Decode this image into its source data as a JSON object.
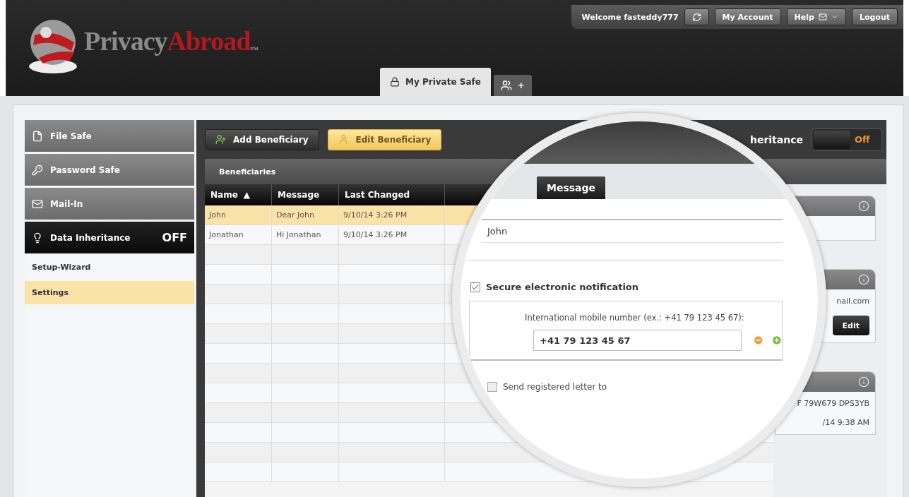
{
  "logo": {
    "part_1": "Privacy",
    "part_2": "Abroad",
    "mark": "TM"
  },
  "user_bar": {
    "welcome": "Welcome fasteddy777",
    "buttons": [
      {
        "label": "My Account",
        "kind": "text"
      },
      {
        "label": "Help",
        "kind": "menu"
      },
      {
        "label": "Logout",
        "kind": "text"
      }
    ]
  },
  "tabs": [
    {
      "label": "My Private Safe",
      "kind": "text",
      "selected": true
    },
    {
      "label": "+",
      "kind": "icon",
      "selected": false
    }
  ],
  "sidebar": {
    "items": [
      {
        "label": "File Safe",
        "selected": false
      },
      {
        "label": "Password Safe",
        "selected": false
      },
      {
        "label": "Mail-In",
        "selected": false
      },
      {
        "label": "Data Inheritance",
        "status": "OFF",
        "selected": true
      }
    ],
    "sub_items": [
      {
        "label": "Setup-Wizard",
        "selected": false
      },
      {
        "label": "Settings",
        "selected": true
      }
    ]
  },
  "toolbar": {
    "buttons": [
      {
        "label": "Add Beneficiary",
        "selected": false
      },
      {
        "label": "Edit Beneficiary",
        "selected": true
      }
    ],
    "inheritance_label": "heritance",
    "toggle": {
      "label": "Off",
      "on": false
    }
  },
  "table": {
    "title": "Beneficiaries",
    "columns": [
      {
        "label": "Name",
        "sort_mark": "▲"
      },
      {
        "label": "Message"
      },
      {
        "label": "Last Changed"
      }
    ],
    "rows": [
      {
        "cells": [
          "John",
          "Dear John",
          "9/10/14 3:26 PM"
        ],
        "selected": true
      },
      {
        "cells": [
          "Jonathan",
          "Hi Jonathan",
          "9/10/14 3:26 PM"
        ],
        "selected": false
      }
    ]
  },
  "side_cards": [
    {
      "kind": "blank"
    },
    {
      "kind": "info",
      "lines": [
        "nail.com"
      ],
      "button": "Edit"
    },
    {
      "kind": "info",
      "lines": [
        "F 79W679 DPS3YB",
        "/14 9:38 AM"
      ]
    }
  ],
  "magnifier": {
    "tab": "Message",
    "name_value": "John",
    "notify": {
      "label": "Secure electronic notification",
      "checked": true
    },
    "mobile_label": "International mobile number (ex.: +41 79 123 45 67):",
    "mobile_value": "+41 79 123 45 67",
    "letter": {
      "label": "Send registered letter to",
      "checked": false
    }
  }
}
